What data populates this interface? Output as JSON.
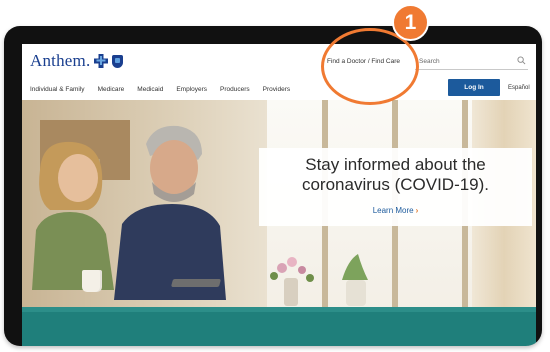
{
  "header": {
    "logo_text": "Anthem.",
    "find_doctor": "Find a Doctor / Find Care",
    "search_placeholder": "Search"
  },
  "nav": {
    "items": [
      {
        "label": "Individual & Family"
      },
      {
        "label": "Medicare"
      },
      {
        "label": "Medicaid"
      },
      {
        "label": "Employers"
      },
      {
        "label": "Producers"
      },
      {
        "label": "Providers"
      }
    ],
    "login_label": "Log In",
    "language_label": "Español"
  },
  "hero": {
    "title": "Stay informed about the coronavirus (COVID-19).",
    "link_label": "Learn More",
    "link_chevron": "›"
  },
  "annotation": {
    "step_number": "1",
    "accent_color": "#f07a32"
  },
  "colors": {
    "brand_blue": "#1a3f8f",
    "button_blue": "#1c5a9c",
    "teal": "#1f7f7b"
  }
}
